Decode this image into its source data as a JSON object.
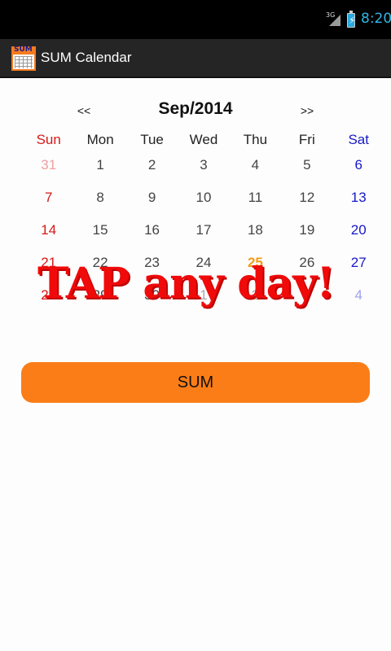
{
  "status_bar": {
    "network_label": "3G",
    "time": "8:20"
  },
  "app": {
    "title": "SUM Calendar",
    "icon_label": "SUM"
  },
  "calendar": {
    "prev_label": "<<",
    "next_label": ">>",
    "month": "Sep/2014",
    "weekdays": [
      "Sun",
      "Mon",
      "Tue",
      "Wed",
      "Thu",
      "Fri",
      "Sat"
    ],
    "weeks": [
      [
        {
          "d": "31",
          "other": true
        },
        {
          "d": "1"
        },
        {
          "d": "2"
        },
        {
          "d": "3"
        },
        {
          "d": "4"
        },
        {
          "d": "5"
        },
        {
          "d": "6"
        }
      ],
      [
        {
          "d": "7"
        },
        {
          "d": "8"
        },
        {
          "d": "9"
        },
        {
          "d": "10"
        },
        {
          "d": "11"
        },
        {
          "d": "12"
        },
        {
          "d": "13"
        }
      ],
      [
        {
          "d": "14"
        },
        {
          "d": "15"
        },
        {
          "d": "16"
        },
        {
          "d": "17"
        },
        {
          "d": "18"
        },
        {
          "d": "19"
        },
        {
          "d": "20"
        }
      ],
      [
        {
          "d": "21"
        },
        {
          "d": "22"
        },
        {
          "d": "23"
        },
        {
          "d": "24"
        },
        {
          "d": "25",
          "today": true
        },
        {
          "d": "26"
        },
        {
          "d": "27"
        }
      ],
      [
        {
          "d": "28"
        },
        {
          "d": "29"
        },
        {
          "d": "30"
        },
        {
          "d": "1",
          "other": true
        },
        {
          "d": "2",
          "other": true
        },
        {
          "d": "3",
          "other": true
        },
        {
          "d": "4",
          "other": true
        }
      ]
    ],
    "today_color": "#f39a1a",
    "sunday_color": "#d81818",
    "saturday_color": "#1818c8"
  },
  "overlay": {
    "text": "TAP any day!"
  },
  "sum_button": {
    "label": "SUM",
    "color": "#fb7d17"
  }
}
